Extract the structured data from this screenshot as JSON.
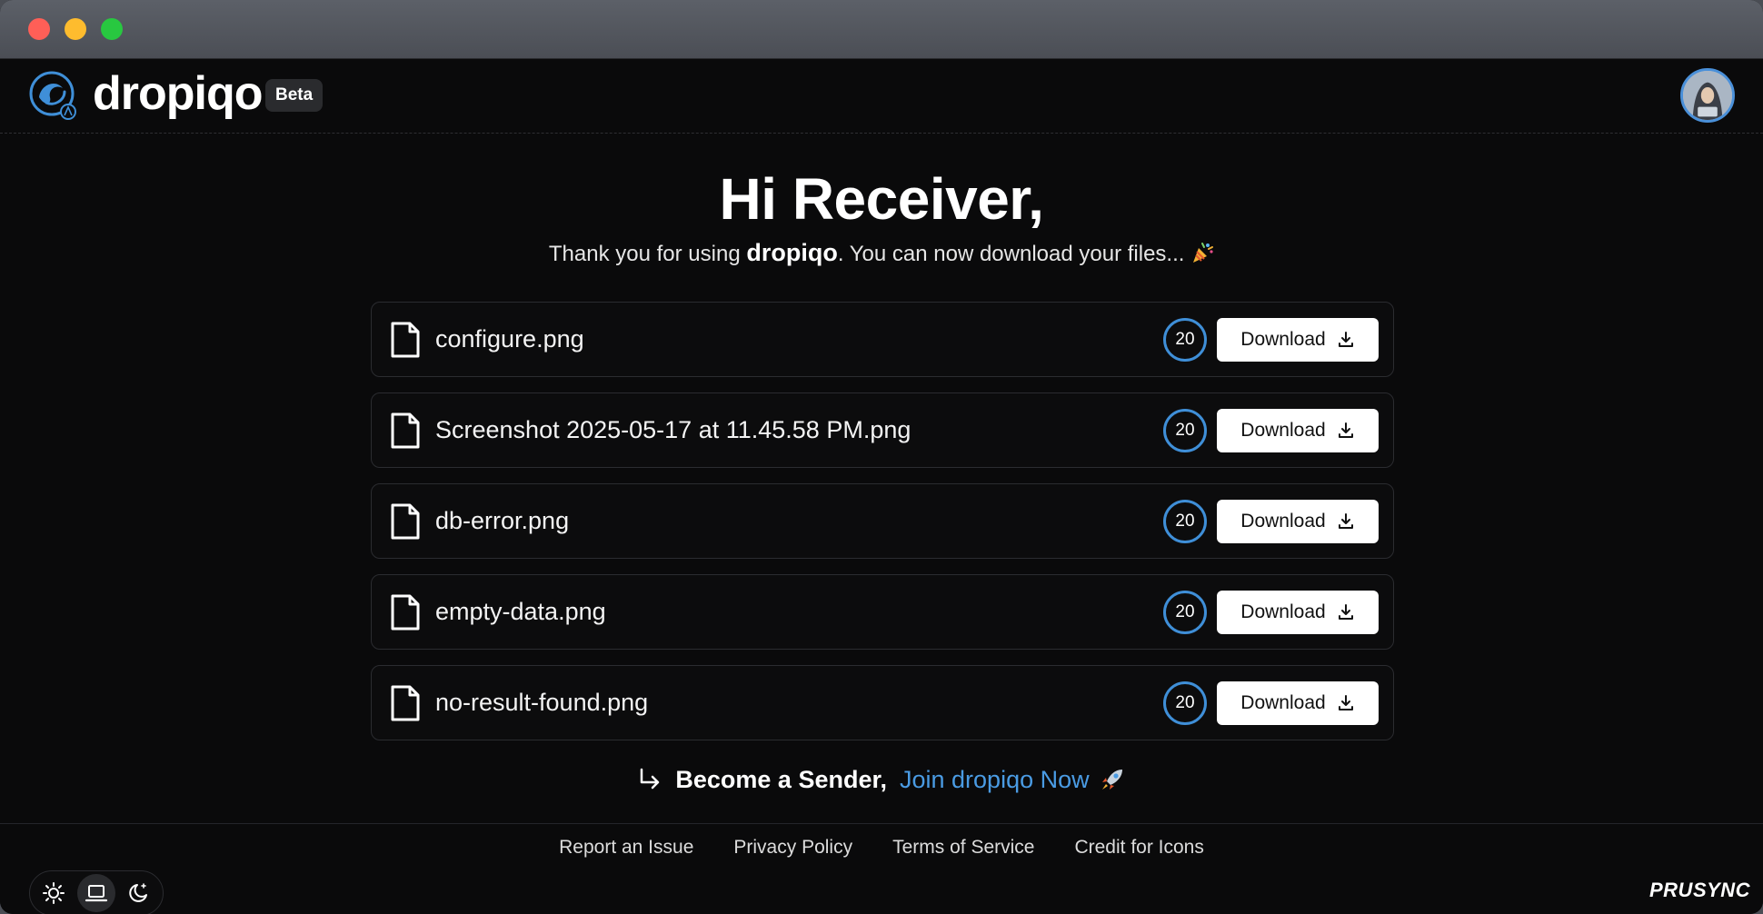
{
  "app": {
    "brand": "dropiqo",
    "badge": "Beta"
  },
  "main": {
    "greeting": "Hi Receiver,",
    "subtitle_before": "Thank you for using ",
    "subtitle_brand": "dropiqo",
    "subtitle_after": ". You can now download your files...",
    "subtitle_emoji": "party-popper-icon"
  },
  "files": [
    {
      "name": "configure.png",
      "count": "20",
      "action": "Download"
    },
    {
      "name": "Screenshot 2025-05-17 at 11.45.58 PM.png",
      "count": "20",
      "action": "Download"
    },
    {
      "name": "db-error.png",
      "count": "20",
      "action": "Download"
    },
    {
      "name": "empty-data.png",
      "count": "20",
      "action": "Download"
    },
    {
      "name": "no-result-found.png",
      "count": "20",
      "action": "Download"
    }
  ],
  "cta": {
    "lead": "Become a Sender,",
    "link": "Join dropiqo Now"
  },
  "footer": {
    "links": [
      "Report an Issue",
      "Privacy Policy",
      "Terms of Service",
      "Credit for Icons"
    ],
    "theme_options": [
      "sun-icon",
      "laptop-icon",
      "moon-icon"
    ],
    "theme_active": "laptop-icon",
    "credit": "PRUSYNC"
  },
  "colors": {
    "background": "#0a0a0b",
    "accent": "#4a9be3",
    "button": "#ffffff"
  }
}
